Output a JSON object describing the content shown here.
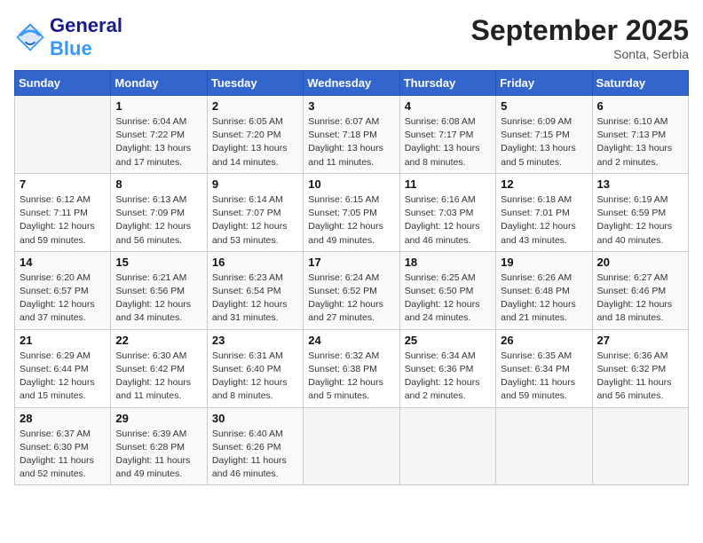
{
  "header": {
    "logo_text_general": "General",
    "logo_text_blue": "Blue",
    "month_title": "September 2025",
    "location": "Sonta, Serbia"
  },
  "weekdays": [
    "Sunday",
    "Monday",
    "Tuesday",
    "Wednesday",
    "Thursday",
    "Friday",
    "Saturday"
  ],
  "weeks": [
    [
      {
        "day": "",
        "info": ""
      },
      {
        "day": "1",
        "info": "Sunrise: 6:04 AM\nSunset: 7:22 PM\nDaylight: 13 hours\nand 17 minutes."
      },
      {
        "day": "2",
        "info": "Sunrise: 6:05 AM\nSunset: 7:20 PM\nDaylight: 13 hours\nand 14 minutes."
      },
      {
        "day": "3",
        "info": "Sunrise: 6:07 AM\nSunset: 7:18 PM\nDaylight: 13 hours\nand 11 minutes."
      },
      {
        "day": "4",
        "info": "Sunrise: 6:08 AM\nSunset: 7:17 PM\nDaylight: 13 hours\nand 8 minutes."
      },
      {
        "day": "5",
        "info": "Sunrise: 6:09 AM\nSunset: 7:15 PM\nDaylight: 13 hours\nand 5 minutes."
      },
      {
        "day": "6",
        "info": "Sunrise: 6:10 AM\nSunset: 7:13 PM\nDaylight: 13 hours\nand 2 minutes."
      }
    ],
    [
      {
        "day": "7",
        "info": "Sunrise: 6:12 AM\nSunset: 7:11 PM\nDaylight: 12 hours\nand 59 minutes."
      },
      {
        "day": "8",
        "info": "Sunrise: 6:13 AM\nSunset: 7:09 PM\nDaylight: 12 hours\nand 56 minutes."
      },
      {
        "day": "9",
        "info": "Sunrise: 6:14 AM\nSunset: 7:07 PM\nDaylight: 12 hours\nand 53 minutes."
      },
      {
        "day": "10",
        "info": "Sunrise: 6:15 AM\nSunset: 7:05 PM\nDaylight: 12 hours\nand 49 minutes."
      },
      {
        "day": "11",
        "info": "Sunrise: 6:16 AM\nSunset: 7:03 PM\nDaylight: 12 hours\nand 46 minutes."
      },
      {
        "day": "12",
        "info": "Sunrise: 6:18 AM\nSunset: 7:01 PM\nDaylight: 12 hours\nand 43 minutes."
      },
      {
        "day": "13",
        "info": "Sunrise: 6:19 AM\nSunset: 6:59 PM\nDaylight: 12 hours\nand 40 minutes."
      }
    ],
    [
      {
        "day": "14",
        "info": "Sunrise: 6:20 AM\nSunset: 6:57 PM\nDaylight: 12 hours\nand 37 minutes."
      },
      {
        "day": "15",
        "info": "Sunrise: 6:21 AM\nSunset: 6:56 PM\nDaylight: 12 hours\nand 34 minutes."
      },
      {
        "day": "16",
        "info": "Sunrise: 6:23 AM\nSunset: 6:54 PM\nDaylight: 12 hours\nand 31 minutes."
      },
      {
        "day": "17",
        "info": "Sunrise: 6:24 AM\nSunset: 6:52 PM\nDaylight: 12 hours\nand 27 minutes."
      },
      {
        "day": "18",
        "info": "Sunrise: 6:25 AM\nSunset: 6:50 PM\nDaylight: 12 hours\nand 24 minutes."
      },
      {
        "day": "19",
        "info": "Sunrise: 6:26 AM\nSunset: 6:48 PM\nDaylight: 12 hours\nand 21 minutes."
      },
      {
        "day": "20",
        "info": "Sunrise: 6:27 AM\nSunset: 6:46 PM\nDaylight: 12 hours\nand 18 minutes."
      }
    ],
    [
      {
        "day": "21",
        "info": "Sunrise: 6:29 AM\nSunset: 6:44 PM\nDaylight: 12 hours\nand 15 minutes."
      },
      {
        "day": "22",
        "info": "Sunrise: 6:30 AM\nSunset: 6:42 PM\nDaylight: 12 hours\nand 11 minutes."
      },
      {
        "day": "23",
        "info": "Sunrise: 6:31 AM\nSunset: 6:40 PM\nDaylight: 12 hours\nand 8 minutes."
      },
      {
        "day": "24",
        "info": "Sunrise: 6:32 AM\nSunset: 6:38 PM\nDaylight: 12 hours\nand 5 minutes."
      },
      {
        "day": "25",
        "info": "Sunrise: 6:34 AM\nSunset: 6:36 PM\nDaylight: 12 hours\nand 2 minutes."
      },
      {
        "day": "26",
        "info": "Sunrise: 6:35 AM\nSunset: 6:34 PM\nDaylight: 11 hours\nand 59 minutes."
      },
      {
        "day": "27",
        "info": "Sunrise: 6:36 AM\nSunset: 6:32 PM\nDaylight: 11 hours\nand 56 minutes."
      }
    ],
    [
      {
        "day": "28",
        "info": "Sunrise: 6:37 AM\nSunset: 6:30 PM\nDaylight: 11 hours\nand 52 minutes."
      },
      {
        "day": "29",
        "info": "Sunrise: 6:39 AM\nSunset: 6:28 PM\nDaylight: 11 hours\nand 49 minutes."
      },
      {
        "day": "30",
        "info": "Sunrise: 6:40 AM\nSunset: 6:26 PM\nDaylight: 11 hours\nand 46 minutes."
      },
      {
        "day": "",
        "info": ""
      },
      {
        "day": "",
        "info": ""
      },
      {
        "day": "",
        "info": ""
      },
      {
        "day": "",
        "info": ""
      }
    ]
  ]
}
